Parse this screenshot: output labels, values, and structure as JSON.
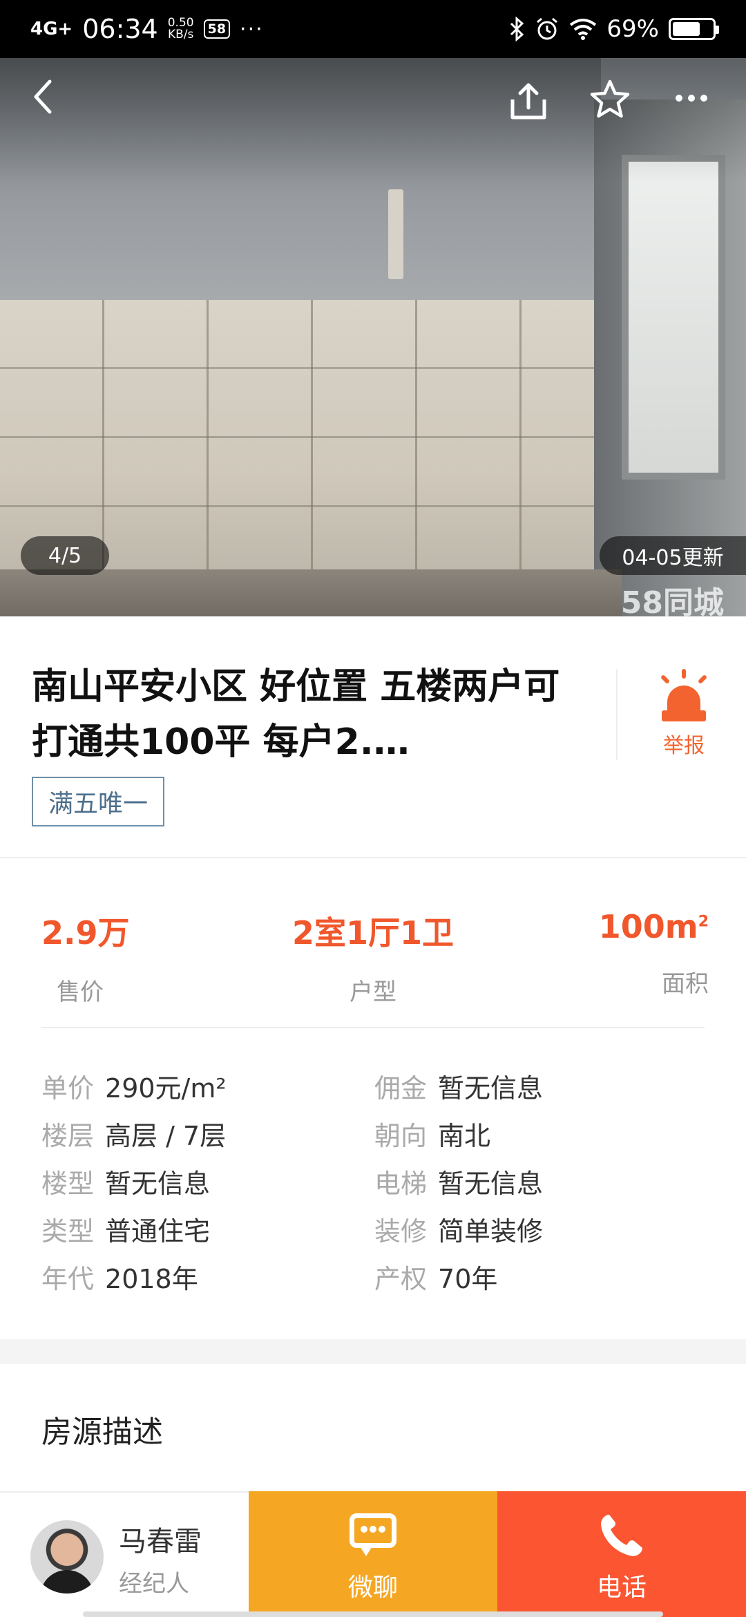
{
  "status_bar": {
    "network": "4G+",
    "time": "06:34",
    "speed_value": "0.50",
    "speed_unit": "KB/s",
    "app_badge": "58",
    "more": "···",
    "battery_percent": "69%",
    "battery_level": 0.69
  },
  "hero": {
    "counter": "4/5",
    "update": "04-05更新",
    "watermark": "58同城"
  },
  "listing": {
    "title": "南山平安小区 好位置 五楼两户可打通共100平 每户2.…",
    "tag": "满五唯一",
    "report_label": "举报"
  },
  "facts": {
    "price_value": "2.9万",
    "price_label": "售价",
    "layout_value": "2室1厅1卫",
    "layout_label": "户型",
    "area_value": "100m",
    "area_sup": "2",
    "area_label": "面积"
  },
  "details": [
    {
      "lk": "单价",
      "lv": "290元/m²",
      "rk": "佣金",
      "rv": "暂无信息"
    },
    {
      "lk": "楼层",
      "lv": "高层 / 7层",
      "rk": "朝向",
      "rv": "南北"
    },
    {
      "lk": "楼型",
      "lv": "暂无信息",
      "rk": "电梯",
      "rv": "暂无信息"
    },
    {
      "lk": "类型",
      "lv": "普通住宅",
      "rk": "装修",
      "rv": "简单装修"
    },
    {
      "lk": "年代",
      "lv": "2018年",
      "rk": "产权",
      "rv": "70年"
    }
  ],
  "description": {
    "title": "房源描述"
  },
  "bottom_bar": {
    "agent_name": "马春雷",
    "agent_role": "经纪人",
    "chat_label": "微聊",
    "call_label": "电话",
    "chat_color": "#f5a723",
    "call_color": "#fb5531"
  },
  "icons": {
    "back": "chevron-left-icon",
    "share": "share-icon",
    "favorite": "star-icon",
    "more": "more-icon",
    "report": "siren-icon",
    "chat": "chat-bubble-icon",
    "call": "phone-icon"
  }
}
